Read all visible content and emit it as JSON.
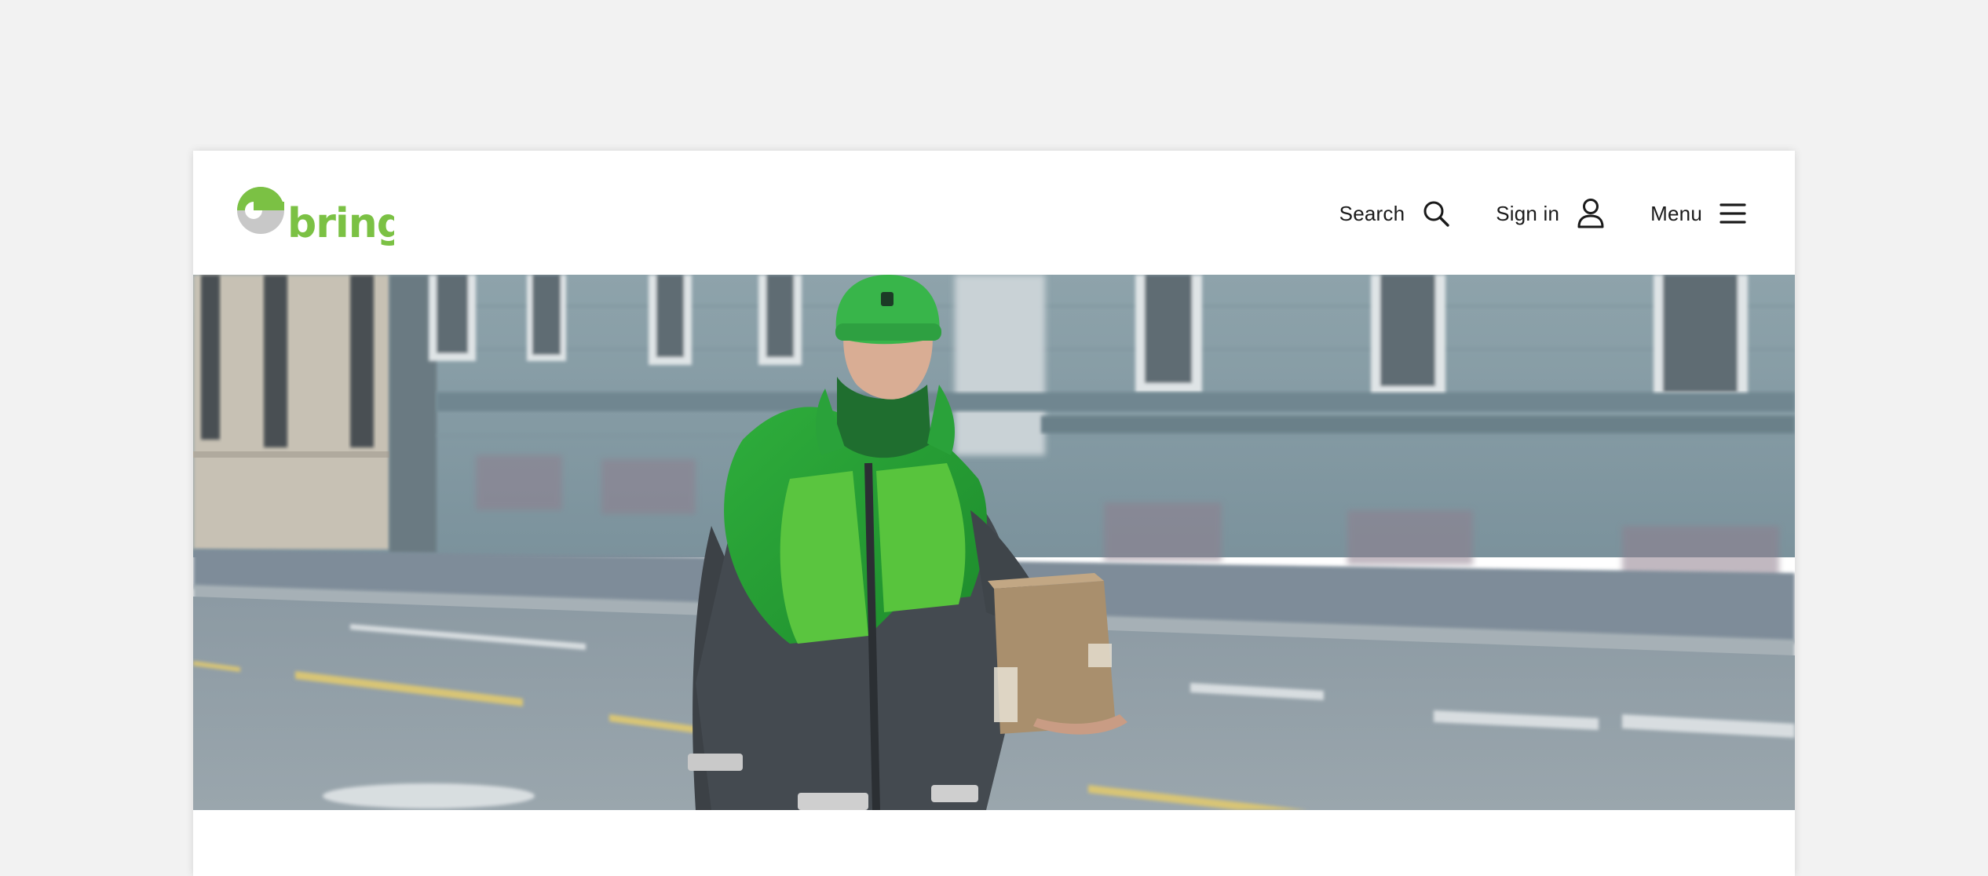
{
  "colors": {
    "brand_green": "#7bc144",
    "logo_grey": "#c8c8c8",
    "text": "#1a1a1a",
    "page_background": "#f2f2f2"
  },
  "header": {
    "logo_text": "bring",
    "nav": {
      "search_label": "Search",
      "search_icon": "search-icon",
      "signin_label": "Sign in",
      "signin_icon": "user-icon",
      "menu_label": "Menu",
      "menu_icon": "hamburger-menu-icon"
    }
  },
  "hero": {
    "subject": "courier in green jacket carrying parcel on street"
  }
}
